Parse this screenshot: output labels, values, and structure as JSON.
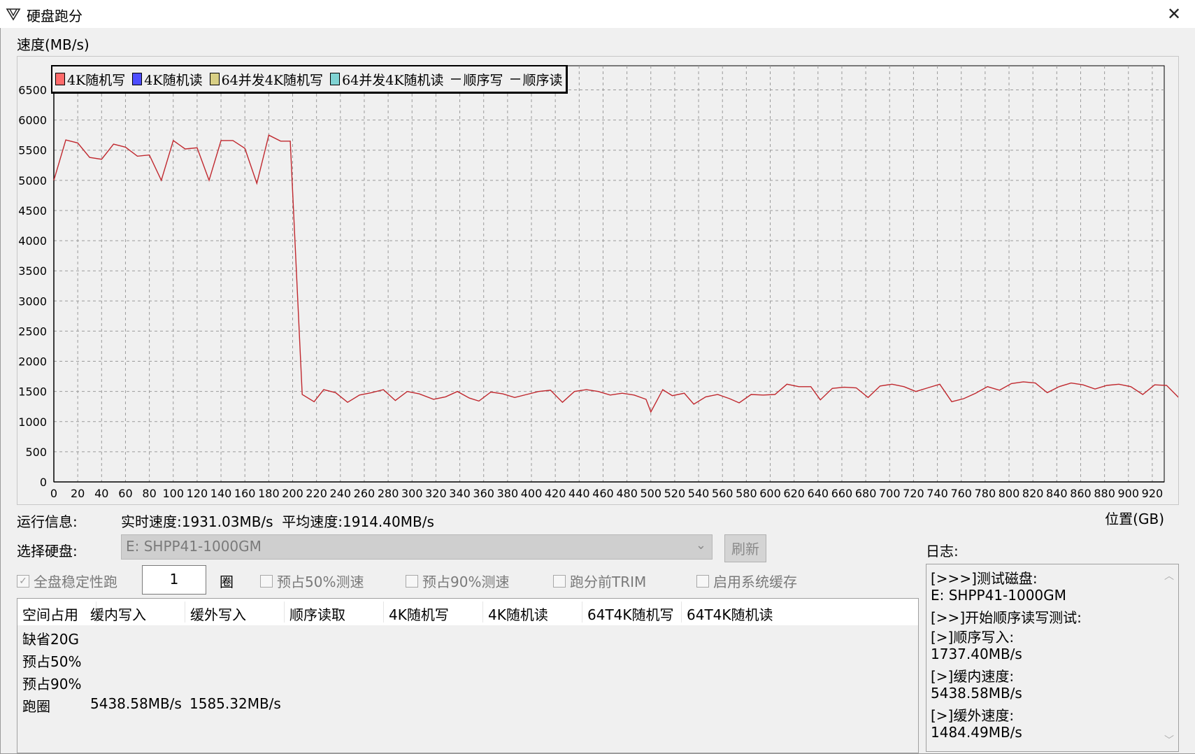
{
  "window": {
    "title": "硬盘跑分",
    "close_label": "✕"
  },
  "chart_data": {
    "type": "line",
    "title": "",
    "ylabel": "速度(MB/s)",
    "xlabel": "位置(GB)",
    "ylim": [
      0,
      6900
    ],
    "xlim": [
      0,
      930
    ],
    "yticks": [
      0,
      500,
      1000,
      1500,
      2000,
      2500,
      3000,
      3500,
      4000,
      4500,
      5000,
      5500,
      6000,
      6500
    ],
    "xticks": [
      0,
      20,
      40,
      60,
      80,
      100,
      120,
      140,
      160,
      180,
      200,
      220,
      240,
      260,
      280,
      300,
      320,
      340,
      360,
      380,
      400,
      420,
      440,
      460,
      480,
      500,
      520,
      540,
      560,
      580,
      600,
      620,
      640,
      660,
      680,
      700,
      720,
      740,
      760,
      780,
      800,
      820,
      840,
      860,
      880,
      900,
      920
    ],
    "grid": true,
    "legend_placement": "top-left",
    "legend": [
      {
        "label": "4K随机写",
        "kind": "box",
        "color": "#ff6b6b"
      },
      {
        "label": "4K随机读",
        "kind": "box",
        "color": "#4d4dff"
      },
      {
        "label": "64并发4K随机写",
        "kind": "box",
        "color": "#d8cf84"
      },
      {
        "label": "64并发4K随机读",
        "kind": "box",
        "color": "#7fd3d3"
      },
      {
        "label": "顺序写",
        "kind": "line",
        "color": "#555555"
      },
      {
        "label": "顺序读",
        "kind": "line",
        "color": "#555555"
      }
    ],
    "series": [
      {
        "name": "顺序写",
        "color": "#c0282e",
        "points": [
          [
            0,
            5000
          ],
          [
            10,
            5670
          ],
          [
            20,
            5620
          ],
          [
            30,
            5380
          ],
          [
            40,
            5350
          ],
          [
            50,
            5600
          ],
          [
            60,
            5550
          ],
          [
            70,
            5400
          ],
          [
            80,
            5420
          ],
          [
            90,
            5000
          ],
          [
            100,
            5660
          ],
          [
            110,
            5520
          ],
          [
            120,
            5540
          ],
          [
            130,
            5000
          ],
          [
            140,
            5660
          ],
          [
            150,
            5660
          ],
          [
            160,
            5530
          ],
          [
            170,
            4950
          ],
          [
            180,
            5750
          ],
          [
            190,
            5650
          ],
          [
            198,
            5650
          ],
          [
            208,
            1450
          ],
          [
            218,
            1330
          ],
          [
            226,
            1530
          ],
          [
            236,
            1480
          ],
          [
            246,
            1320
          ],
          [
            256,
            1440
          ],
          [
            266,
            1480
          ],
          [
            276,
            1530
          ],
          [
            286,
            1350
          ],
          [
            296,
            1500
          ],
          [
            306,
            1460
          ],
          [
            318,
            1370
          ],
          [
            328,
            1410
          ],
          [
            338,
            1500
          ],
          [
            348,
            1390
          ],
          [
            356,
            1340
          ],
          [
            366,
            1490
          ],
          [
            376,
            1460
          ],
          [
            386,
            1400
          ],
          [
            396,
            1450
          ],
          [
            406,
            1500
          ],
          [
            416,
            1520
          ],
          [
            426,
            1320
          ],
          [
            436,
            1500
          ],
          [
            446,
            1530
          ],
          [
            456,
            1500
          ],
          [
            466,
            1440
          ],
          [
            476,
            1470
          ],
          [
            486,
            1440
          ],
          [
            496,
            1370
          ],
          [
            500,
            1160
          ],
          [
            510,
            1530
          ],
          [
            518,
            1430
          ],
          [
            528,
            1470
          ],
          [
            536,
            1290
          ],
          [
            546,
            1410
          ],
          [
            556,
            1450
          ],
          [
            566,
            1380
          ],
          [
            574,
            1310
          ],
          [
            584,
            1450
          ],
          [
            594,
            1440
          ],
          [
            604,
            1450
          ],
          [
            614,
            1620
          ],
          [
            624,
            1580
          ],
          [
            634,
            1580
          ],
          [
            642,
            1360
          ],
          [
            652,
            1550
          ],
          [
            662,
            1570
          ],
          [
            672,
            1560
          ],
          [
            682,
            1400
          ],
          [
            692,
            1590
          ],
          [
            702,
            1620
          ],
          [
            712,
            1580
          ],
          [
            722,
            1500
          ],
          [
            732,
            1560
          ],
          [
            742,
            1620
          ],
          [
            752,
            1330
          ],
          [
            762,
            1380
          ],
          [
            772,
            1470
          ],
          [
            782,
            1580
          ],
          [
            792,
            1520
          ],
          [
            802,
            1630
          ],
          [
            812,
            1660
          ],
          [
            822,
            1640
          ],
          [
            832,
            1480
          ],
          [
            842,
            1580
          ],
          [
            852,
            1640
          ],
          [
            862,
            1610
          ],
          [
            872,
            1540
          ],
          [
            882,
            1600
          ],
          [
            892,
            1620
          ],
          [
            902,
            1580
          ],
          [
            912,
            1450
          ],
          [
            922,
            1610
          ],
          [
            932,
            1600
          ],
          [
            942,
            1400
          ]
        ]
      }
    ]
  },
  "run": {
    "label": "运行信息:",
    "info": "实时速度:1931.03MB/s  平均速度:1914.40MB/s"
  },
  "disk": {
    "label": "选择硬盘:",
    "selected": "E: SHPP41-1000GM",
    "refresh_label": "刷新"
  },
  "options": {
    "full_disk_stability": {
      "label": "全盘稳定性跑",
      "checked": true
    },
    "laps_value": "1",
    "laps_unit": "圈",
    "prefill_50": {
      "label": "预占50%测速",
      "checked": false
    },
    "prefill_90": {
      "label": "预占90%测速",
      "checked": false
    },
    "trim_before": {
      "label": "跑分前TRIM",
      "checked": false
    },
    "enable_cache": {
      "label": "启用系统缓存",
      "checked": false
    }
  },
  "table": {
    "headers": [
      "空间占用",
      "缓内写入",
      "缓外写入",
      "顺序读取",
      "4K随机写",
      "4K随机读",
      "64T4K随机写",
      "64T4K随机读"
    ],
    "rows": [
      [
        "缺省20G",
        "",
        "",
        "",
        "",
        "",
        "",
        ""
      ],
      [
        "预占50%",
        "",
        "",
        "",
        "",
        "",
        "",
        ""
      ],
      [
        "预占90%",
        "",
        "",
        "",
        "",
        "",
        "",
        ""
      ],
      [
        "跑圈",
        "5438.58MB/s",
        "1585.32MB/s",
        "",
        "",
        "",
        "",
        ""
      ]
    ]
  },
  "log": {
    "label": "日志:",
    "lines": [
      "[>>>]测试磁盘:",
      "E: SHPP41-1000GM",
      "[>>]开始顺序读写测试:",
      "[>]顺序写入:",
      "1737.40MB/s",
      "[>]缓内速度:",
      "5438.58MB/s",
      "[>]缓外速度:",
      "1484.49MB/s"
    ]
  },
  "icons": {
    "app": "app-logo-icon",
    "checkmark": "✓",
    "dropdown": "chevron-down-icon"
  }
}
